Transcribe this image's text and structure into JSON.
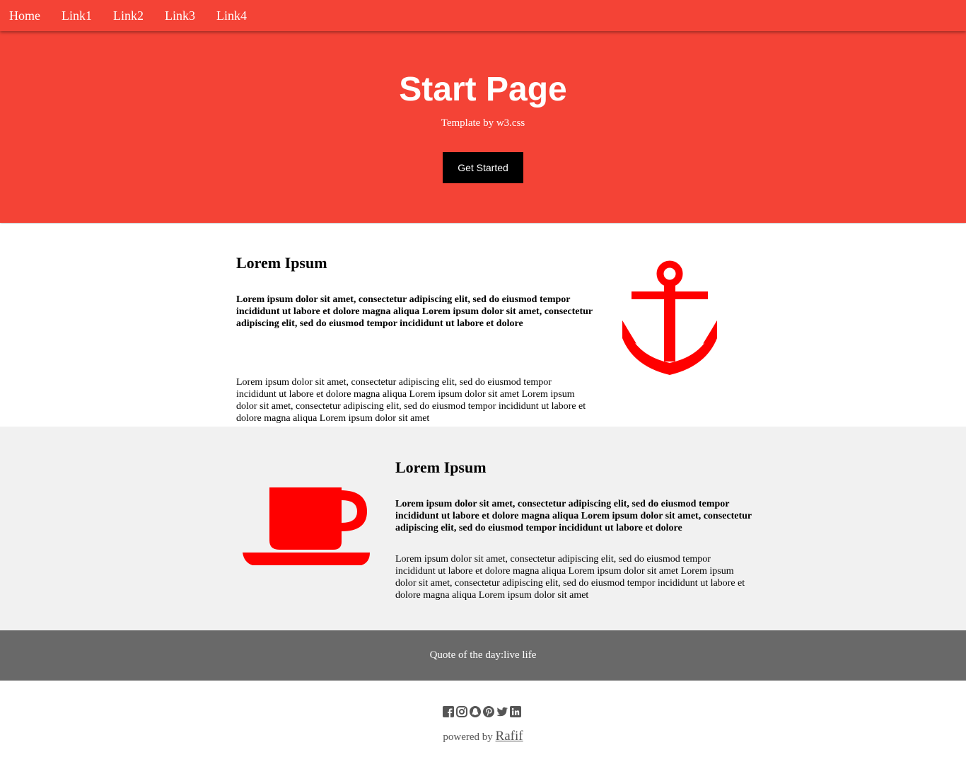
{
  "nav": {
    "links": [
      "Home",
      "Link1",
      "Link2",
      "Link3",
      "Link4"
    ]
  },
  "header": {
    "title": "Start Page",
    "subtitle": "Template by w3.css",
    "button": "Get Started"
  },
  "section1": {
    "heading": "Lorem Ipsum",
    "bold_text": "Lorem ipsum dolor sit amet, consectetur adipiscing elit, sed do eiusmod tempor incididunt ut labore et dolore magna aliqua Lorem ipsum dolor sit amet, consectetur adipiscing elit, sed do eiusmod tempor incididunt ut labore et dolore",
    "plain_text": "Lorem ipsum dolor sit amet, consectetur adipiscing elit, sed do eiusmod tempor incididunt ut labore et dolore magna aliqua Lorem ipsum dolor sit amet Lorem ipsum dolor sit amet, consectetur adipiscing elit, sed do eiusmod tempor incididunt ut labore et dolore magna aliqua Lorem ipsum dolor sit amet",
    "icon": "anchor-icon"
  },
  "section2": {
    "heading": "Lorem Ipsum",
    "bold_text": "Lorem ipsum dolor sit amet, consectetur adipiscing elit, sed do eiusmod tempor incididunt ut labore et dolore magna aliqua Lorem ipsum dolor sit amet, consectetur adipiscing elit, sed do eiusmod tempor incididunt ut labore et dolore",
    "plain_text": "Lorem ipsum dolor sit amet, consectetur adipiscing elit, sed do eiusmod tempor incididunt ut labore et dolore magna aliqua Lorem ipsum dolor sit amet Lorem ipsum dolor sit amet, consectetur adipiscing elit, sed do eiusmod tempor incididunt ut labore et dolore magna aliqua Lorem ipsum dolor sit amet",
    "icon": "coffee-cup-icon"
  },
  "quote": {
    "text": "Quote of the day:live life"
  },
  "footer": {
    "social_icons": [
      "facebook-icon",
      "instagram-icon",
      "snapchat-icon",
      "pinterest-icon",
      "twitter-icon",
      "linkedin-icon"
    ],
    "powered_prefix": "powered by",
    "powered_name": "Rafif"
  },
  "colors": {
    "primary": "#f44336",
    "icon_red": "#ff0000",
    "quote_bg": "#696969",
    "light_bg": "#f1f1f1"
  }
}
